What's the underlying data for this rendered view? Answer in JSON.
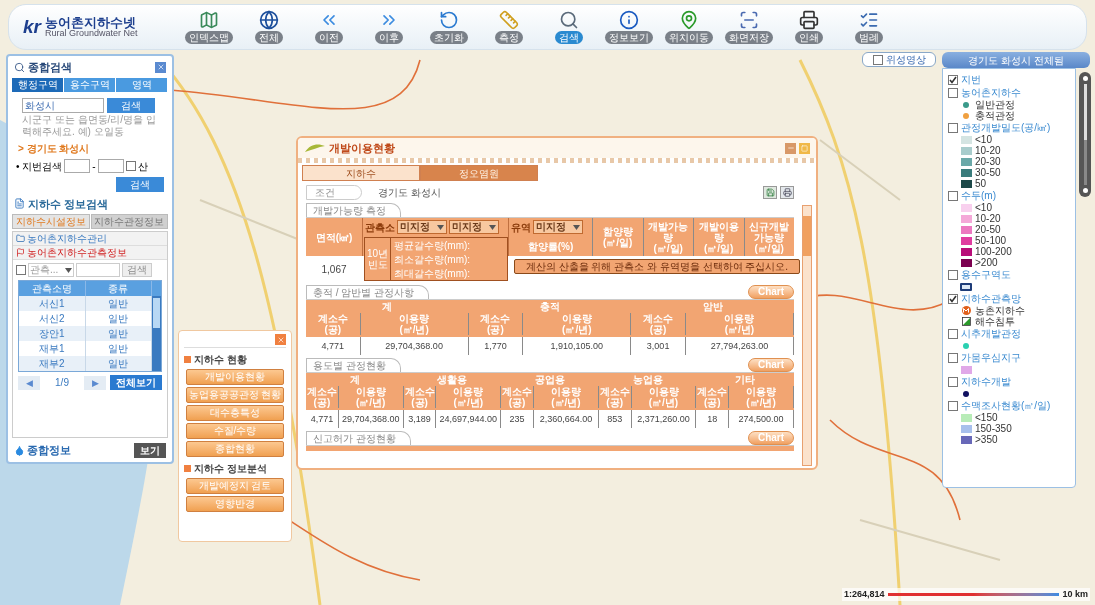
{
  "toolbar": {
    "logo_mark": "kr",
    "logo_text": "농어촌지하수넷",
    "logo_subtitle": "Rural Groundwater Net",
    "tools": [
      {
        "label": "인덱스맵",
        "selected": false
      },
      {
        "label": "전체",
        "selected": false
      },
      {
        "label": "이전",
        "selected": false
      },
      {
        "label": "이후",
        "selected": false
      },
      {
        "label": "초기화",
        "selected": false
      },
      {
        "label": "측정",
        "selected": false
      },
      {
        "label": "검색",
        "selected": true
      },
      {
        "label": "정보보기",
        "selected": false
      },
      {
        "label": "위치이동",
        "selected": false
      },
      {
        "label": "화면저장",
        "selected": false
      },
      {
        "label": "인쇄",
        "selected": false
      },
      {
        "label": "범례",
        "selected": false
      }
    ]
  },
  "map_controls": {
    "satellite": {
      "label": "위성영상",
      "checked": false
    },
    "region_button": "경기도 화성시 전체됨",
    "zoom": {
      "level": 0.55
    }
  },
  "search_panel": {
    "title": "종합검색",
    "tabs": [
      {
        "label": "행정구역",
        "selected": true
      },
      {
        "label": "용수구역",
        "selected": false
      },
      {
        "label": "영역",
        "selected": false
      }
    ],
    "query": {
      "value": "화성시",
      "button": "검색"
    },
    "hint": "시군구 또는 읍면동/리/명을 입력해주세요. 예) 오일동",
    "location": "> 경기도 화성시",
    "parcel": {
      "label": "• 지번검색",
      "separator": "-",
      "mountain_label": "산",
      "mountain_checked": false,
      "button": "검색"
    },
    "info_title": "지하수 정보검색",
    "info_tabs": [
      {
        "label": "지하수시설정보",
        "selected": true
      },
      {
        "label": "지하수관정정보",
        "selected": false
      }
    ],
    "categories": [
      {
        "label": "농어촌지하수관리",
        "selected": false
      },
      {
        "label": "농어촌지하수관측정보",
        "selected": true
      }
    ],
    "filter": {
      "checked": false,
      "select": "관측...",
      "button": "검색"
    },
    "table": {
      "columns": [
        "관측소명",
        "종류"
      ],
      "rows": [
        [
          "서신1",
          "일반"
        ],
        [
          "서신2",
          "일반"
        ],
        [
          "장안1",
          "일반"
        ],
        [
          "재부1",
          "일반"
        ],
        [
          "재부2",
          "일반"
        ]
      ]
    },
    "pager": {
      "prev": "◀",
      "page": "1/9",
      "next": "▶",
      "all_button": "전체보기"
    },
    "footer": {
      "label": "종합정보",
      "button": "보기"
    }
  },
  "dialog": {
    "title": "개발이용현황",
    "tabs": [
      {
        "label": "지하수",
        "selected": true
      },
      {
        "label": "정오염원",
        "selected": false
      }
    ],
    "condition": {
      "label": "조건",
      "value": "경기도 화성시"
    },
    "dev": {
      "title": "개발가능량 측정",
      "area_header": "면적(㎢)",
      "station_label": "관측소",
      "station_selects": [
        "미지정",
        "미지정"
      ],
      "basin_label": "유역",
      "basin_select": "미지정",
      "rate_header": "함양률(%)",
      "headers": [
        "함양량\n(㎥/일)",
        "개발가능량\n(㎥/일)",
        "개발이용량\n(㎥/일)",
        "신규개발\n가능량\n(㎥/일)"
      ],
      "frequency": "10년\n빈도",
      "drought_lines": [
        "평균갈수량(mm):",
        "최소갈수량(mm):",
        "최대갈수량(mm):"
      ],
      "area_value": "1,067",
      "message": "계산의 산출을 위해 관측소 와 유역명을 선택하여 주십시오."
    },
    "sections": [
      {
        "title": "충적 / 암반별 관정사항",
        "chart_button": "Chart",
        "groups": [
          "계",
          "충적",
          "암반"
        ],
        "sub_headers": [
          "계소수\n(공)",
          "이용량\n(㎥/년)",
          "계소수\n(공)",
          "이용량\n(㎥/년)",
          "계소수\n(공)",
          "이용량\n(㎥/년)"
        ],
        "values": [
          "4,771",
          "29,704,368.00",
          "1,770",
          "1,910,105.00",
          "3,001",
          "27,794,263.00"
        ]
      },
      {
        "title": "용도별 관정현황",
        "chart_button": "Chart",
        "groups": [
          "계",
          "생활용",
          "공업용",
          "농업용",
          "기타"
        ],
        "sub_headers": [
          "계소수\n(공)",
          "이용량\n(㎥/년)",
          "계소수\n(공)",
          "이용량\n(㎥/년)",
          "계소수\n(공)",
          "이용량\n(㎥/년)",
          "계소수\n(공)",
          "이용량\n(㎥/년)",
          "계소수\n(공)",
          "이용량\n(㎥/년)"
        ],
        "values": [
          "4,771",
          "29,704,368.00",
          "3,189",
          "24,697,944.00",
          "235",
          "2,360,664.00",
          "853",
          "2,371,260.00",
          "18",
          "274,500.00"
        ]
      },
      {
        "title": "신고허가 관정현황",
        "chart_button": "Chart"
      }
    ]
  },
  "analysis_menu": {
    "groups": [
      {
        "title": "지하수 현황",
        "items": [
          "개발이용현황",
          "농업용공공관정 현황",
          "대수층특성",
          "수질/수량",
          "종합현황"
        ]
      },
      {
        "title": "지하수 정보분석",
        "items": [
          "개발예정지 검토",
          "영향반경"
        ]
      }
    ]
  },
  "legend": {
    "items": [
      {
        "label": "지번",
        "checked": true
      },
      {
        "label": "농어촌지하수",
        "checked": false,
        "children": [
          {
            "kind": "dot",
            "color": "#3a9a8a",
            "label": "일반관정"
          },
          {
            "kind": "dot",
            "color": "#f0a040",
            "label": "충적관정"
          }
        ]
      },
      {
        "label": "관정개발밀도(공/㎢)",
        "checked": false,
        "children": [
          {
            "kind": "swatch",
            "color": "#d4e4e2",
            "label": "<10"
          },
          {
            "kind": "swatch",
            "color": "#a8cccc",
            "label": "10-20"
          },
          {
            "kind": "swatch",
            "color": "#6aa8a8",
            "label": "20-30"
          },
          {
            "kind": "swatch",
            "color": "#3a7c7c",
            "label": "30-50"
          },
          {
            "kind": "swatch",
            "color": "#1c4848",
            "label": "50"
          }
        ]
      },
      {
        "label": "수두(m)",
        "checked": false,
        "children": [
          {
            "kind": "swatch",
            "color": "#f8d0ee",
            "label": "<10"
          },
          {
            "kind": "swatch",
            "color": "#f4a8d8",
            "label": "10-20"
          },
          {
            "kind": "swatch",
            "color": "#ec78c0",
            "label": "20-50"
          },
          {
            "kind": "swatch",
            "color": "#e03ca0",
            "label": "50-100"
          },
          {
            "kind": "swatch",
            "color": "#b80c78",
            "label": "100-200"
          },
          {
            "kind": "swatch",
            "color": "#7c0050",
            "label": ">200"
          }
        ]
      },
      {
        "label": "용수구역도",
        "checked": false,
        "children": [
          {
            "kind": "outline",
            "color": "#1e3c78"
          }
        ]
      },
      {
        "label": "지하수관측망",
        "checked": true,
        "children": [
          {
            "kind": "marker",
            "color": "#e0601c",
            "label": "농촌지하수"
          },
          {
            "kind": "triangle",
            "color": "#2a9a2a",
            "label": "해수침투"
          }
        ]
      },
      {
        "label": "시추개발관정",
        "checked": false,
        "children": [
          {
            "kind": "dot",
            "color": "#2ad0b0"
          }
        ]
      },
      {
        "label": "가뭄우심지구",
        "checked": false,
        "children": [
          {
            "kind": "swatch",
            "color": "#e0a8e8"
          }
        ]
      },
      {
        "label": "지하수개발",
        "checked": false,
        "children": [
          {
            "kind": "dot",
            "color": "#101060"
          }
        ]
      },
      {
        "label": "수맥조사현황(㎥/일)",
        "checked": false,
        "children": [
          {
            "kind": "swatch",
            "color": "#b8ecb8",
            "label": "<150"
          },
          {
            "kind": "swatch",
            "color": "#a8c0ec",
            "label": "150-350"
          },
          {
            "kind": "swatch",
            "color": "#6868b8",
            "label": ">350"
          }
        ]
      }
    ]
  },
  "scale": {
    "ratio": "1:264,814",
    "distance": "10 km"
  }
}
